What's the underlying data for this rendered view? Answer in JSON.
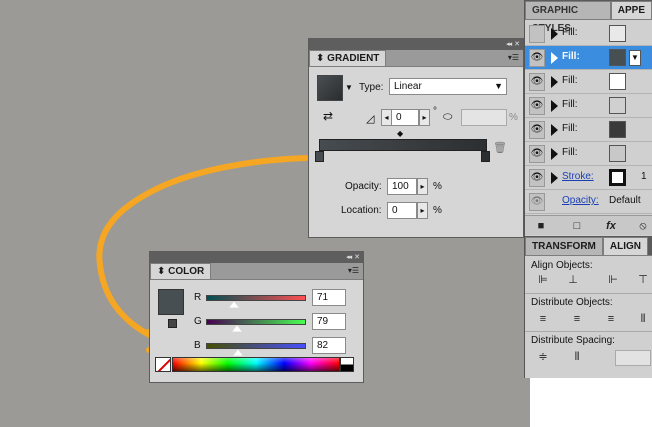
{
  "gradient_panel": {
    "title": "GRADIENT",
    "type_label": "Type:",
    "type_value": "Linear",
    "angle_value": "0",
    "angle_unit": "°",
    "aspect_unit": "%",
    "opacity_label": "Opacity:",
    "opacity_value": "100",
    "opacity_unit": "%",
    "location_label": "Location:",
    "location_value": "0",
    "location_unit": "%",
    "colors": {
      "start": "#474c50",
      "end": "#2c2f31"
    }
  },
  "color_panel": {
    "title": "COLOR",
    "channels": [
      {
        "label": "R",
        "value": "71",
        "fraction": 0.278
      },
      {
        "label": "G",
        "value": "79",
        "fraction": 0.31
      },
      {
        "label": "B",
        "value": "82",
        "fraction": 0.322
      }
    ],
    "swatch_color": "#474f52"
  },
  "graphic_styles": {
    "tabs": [
      "GRAPHIC STYLES",
      "APPE"
    ],
    "rows": [
      {
        "label": "Fill:",
        "eye": false,
        "selected": false,
        "swatch": "#e9e9e9",
        "extra": ""
      },
      {
        "label": "Fill:",
        "eye": true,
        "selected": true,
        "swatch": "#474f52",
        "extra": ""
      },
      {
        "label": "Fill:",
        "eye": true,
        "selected": false,
        "swatch": "#ffffff",
        "extra": ""
      },
      {
        "label": "Fill:",
        "eye": true,
        "selected": false,
        "swatch": "#d0d0d0",
        "extra": ""
      },
      {
        "label": "Fill:",
        "eye": true,
        "selected": false,
        "swatch": "#3a3a3a",
        "extra": ""
      },
      {
        "label": "Fill:",
        "eye": true,
        "selected": false,
        "swatch": "#c8c8c8",
        "extra": ""
      },
      {
        "label": "Stroke:",
        "eye": true,
        "selected": false,
        "swatch": "#ffffff",
        "extra": "1"
      },
      {
        "label": "Opacity:",
        "eye": true,
        "selected": false,
        "swatch": "",
        "extra": "Default"
      }
    ]
  },
  "transform_align": {
    "tabs": [
      "TRANSFORM",
      "ALIGN"
    ],
    "align_objects_label": "Align Objects:",
    "distribute_objects_label": "Distribute Objects:",
    "distribute_spacing_label": "Distribute Spacing:"
  }
}
